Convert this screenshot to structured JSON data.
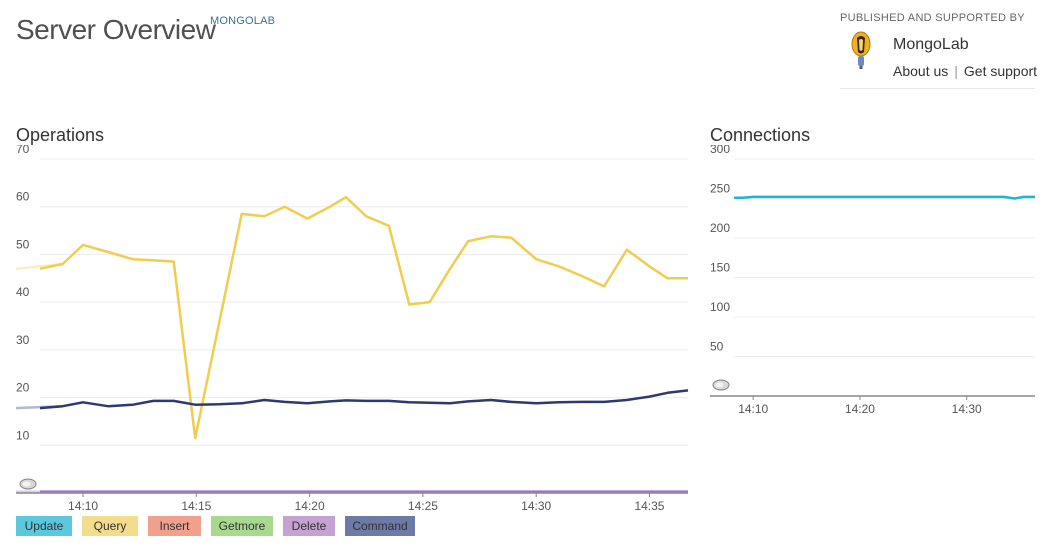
{
  "header": {
    "title": "Server Overview",
    "badge": "MONGOLAB"
  },
  "publisher": {
    "label": "PUBLISHED AND SUPPORTED BY",
    "name": "MongoLab",
    "about_link": "About us",
    "separator": "|",
    "support_link": "Get support"
  },
  "operations": {
    "title": "Operations",
    "legend": [
      {
        "label": "Update",
        "color": "#5bc8dd"
      },
      {
        "label": "Query",
        "color": "#f3dc8c"
      },
      {
        "label": "Insert",
        "color": "#f0a08c"
      },
      {
        "label": "Getmore",
        "color": "#a9d98e"
      },
      {
        "label": "Delete",
        "color": "#c5a2d1"
      },
      {
        "label": "Command",
        "color": "#6e7aa6"
      }
    ]
  },
  "connections": {
    "title": "Connections"
  },
  "chart_data": [
    {
      "type": "line",
      "title": "Operations",
      "ylim": [
        0,
        70
      ],
      "yticks": [
        10,
        20,
        30,
        40,
        50,
        60,
        70
      ],
      "xlim": [
        8.1,
        36.7
      ],
      "xticks": [
        {
          "v": 10,
          "label": "14:10"
        },
        {
          "v": 15,
          "label": "14:15"
        },
        {
          "v": 20,
          "label": "14:20"
        },
        {
          "v": 25,
          "label": "14:25"
        },
        {
          "v": 30,
          "label": "14:30"
        },
        {
          "v": 35,
          "label": "14:35"
        }
      ],
      "grid": true,
      "series": [
        {
          "name": "Query",
          "color": "#f0cc4f",
          "x": [
            7.9,
            9.1,
            10.0,
            11.1,
            12.2,
            13.1,
            14.0,
            14.95,
            16.0,
            17.0,
            18.0,
            18.9,
            19.9,
            20.9,
            21.6,
            22.5,
            23.5,
            24.4,
            25.3,
            26.2,
            27.0,
            28.0,
            28.9,
            30.0,
            31.0,
            32.0,
            33.0,
            34.0,
            35.0,
            35.8,
            36.7
          ],
          "values": [
            47,
            48,
            52,
            50.5,
            49,
            48.8,
            48.5,
            11.5,
            35.5,
            58.5,
            58,
            60,
            57.5,
            60,
            62,
            58,
            56,
            39.5,
            40,
            47,
            52.8,
            53.8,
            53.5,
            49,
            47.5,
            45.5,
            43.3,
            51,
            47.5,
            45,
            45
          ]
        },
        {
          "name": "Command",
          "color": "#2c3a6e",
          "x": [
            7.9,
            9.1,
            10.0,
            11.1,
            12.2,
            13.1,
            14.0,
            14.95,
            16.0,
            17.0,
            18.0,
            18.9,
            19.9,
            20.9,
            21.6,
            22.5,
            23.5,
            24.4,
            25.3,
            26.2,
            27.0,
            28.0,
            28.9,
            30.0,
            31.0,
            32.0,
            33.0,
            34.0,
            35.0,
            35.8,
            36.7
          ],
          "values": [
            17.8,
            18.2,
            19,
            18.2,
            18.5,
            19.3,
            19.3,
            18.5,
            18.6,
            18.8,
            19.5,
            19.1,
            18.8,
            19.2,
            19.4,
            19.3,
            19.3,
            19,
            18.9,
            18.8,
            19.2,
            19.5,
            19.1,
            18.8,
            19,
            19.1,
            19.1,
            19.5,
            20.2,
            21,
            21.5
          ]
        },
        {
          "name": "Update",
          "color": "#9b7bb5",
          "x": [
            7.9,
            36.7
          ],
          "values": [
            0.3,
            0.3
          ]
        }
      ]
    },
    {
      "type": "line",
      "title": "Connections",
      "ylim": [
        0,
        300
      ],
      "yticks": [
        50,
        100,
        150,
        200,
        250,
        300
      ],
      "xlim": [
        8.2,
        36.4
      ],
      "xticks": [
        {
          "v": 10,
          "label": "14:10"
        },
        {
          "v": 20,
          "label": "14:20"
        },
        {
          "v": 30,
          "label": "14:30"
        }
      ],
      "grid": true,
      "series": [
        {
          "name": "Connections",
          "color": "#1fb6cf",
          "x": [
            8.2,
            9.0,
            10.0,
            12.0,
            14.0,
            16.0,
            18.0,
            20.0,
            22.0,
            24.0,
            26.0,
            28.0,
            30.0,
            32.0,
            33.5,
            34.5,
            35.3,
            36.4
          ],
          "values": [
            251,
            251,
            252,
            252,
            252,
            252,
            252,
            252,
            252,
            252,
            252,
            252,
            252,
            252,
            252,
            250,
            252,
            252
          ]
        }
      ]
    }
  ]
}
